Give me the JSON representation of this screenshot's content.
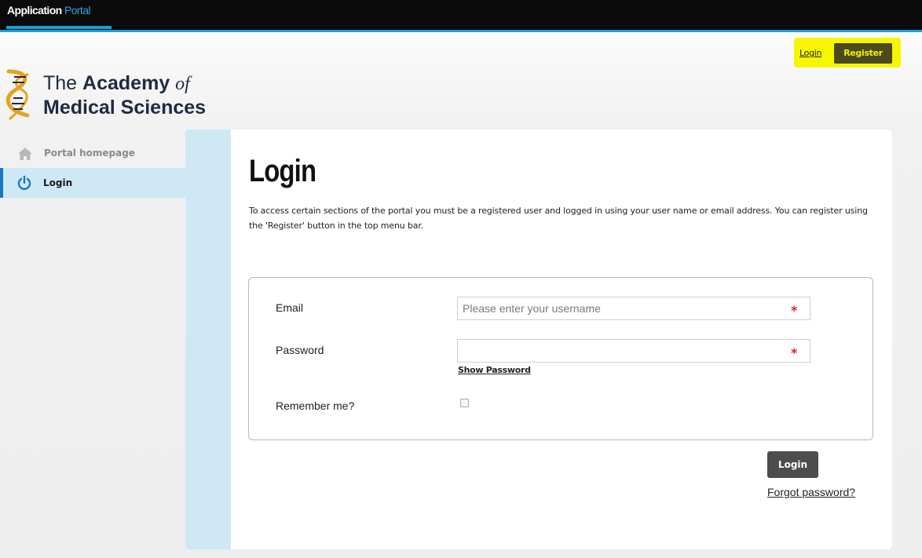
{
  "app": {
    "title_part1": "Application",
    "title_part2": "Portal"
  },
  "header": {
    "login_link": "Login",
    "register_button": "Register",
    "highlight_color": "#f6f600"
  },
  "logo": {
    "line1_prefix": "The",
    "line1_bold": "Academy",
    "line1_italic": "of",
    "line2": "Medical Sciences"
  },
  "sidebar": {
    "items": [
      {
        "label": "Portal homepage",
        "icon": "home-icon",
        "active": false
      },
      {
        "label": "Login",
        "icon": "power-icon",
        "active": true
      }
    ]
  },
  "main": {
    "title": "Login",
    "intro": "To access certain sections of the portal you must be a registered user and logged in using your user name or email address. You can register using the 'Register' button in the top menu bar.",
    "form": {
      "email_label": "Email",
      "email_placeholder": "Please enter your username",
      "email_value": "",
      "password_label": "Password",
      "password_value": "",
      "required_marker": "*",
      "show_password": "Show Password",
      "remember_label": "Remember me?",
      "remember_checked": false
    },
    "login_button": "Login",
    "forgot_password": "Forgot password?"
  },
  "colors": {
    "topbar": "#0b0b0b",
    "accent": "#1a9fd6",
    "sidebar_active": "#cfe8f6",
    "required": "#d9261c"
  }
}
